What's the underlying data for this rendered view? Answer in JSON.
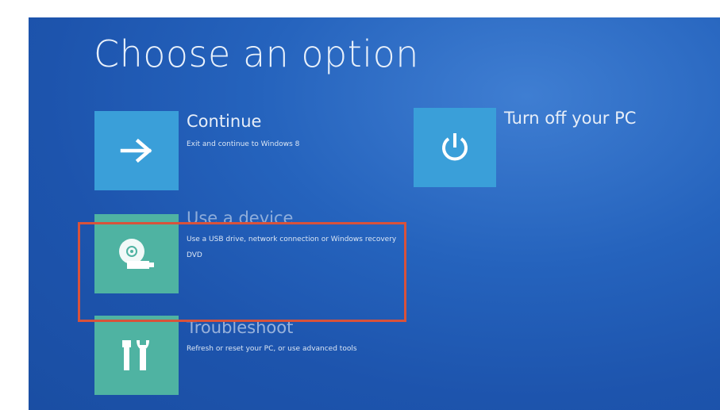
{
  "screen": {
    "title": "Choose an option"
  },
  "options": [
    {
      "title": "Continue",
      "description": "Exit and continue to Windows 8",
      "icon": "arrow-right-icon"
    },
    {
      "title": "Turn off your PC",
      "description": "",
      "icon": "power-icon"
    },
    {
      "title": "Use a device",
      "description": "Use a USB drive, network connection or Windows recovery DVD",
      "icon": "disc-drive-icon"
    },
    {
      "title": "Troubleshoot",
      "description": "Refresh or reset your PC, or use advanced tools",
      "icon": "tools-icon"
    }
  ],
  "colors": {
    "background": "#2563bd",
    "tile_blue": "#3a9fd9",
    "tile_green": "#4fb3a2",
    "highlight": "#d8523b"
  }
}
